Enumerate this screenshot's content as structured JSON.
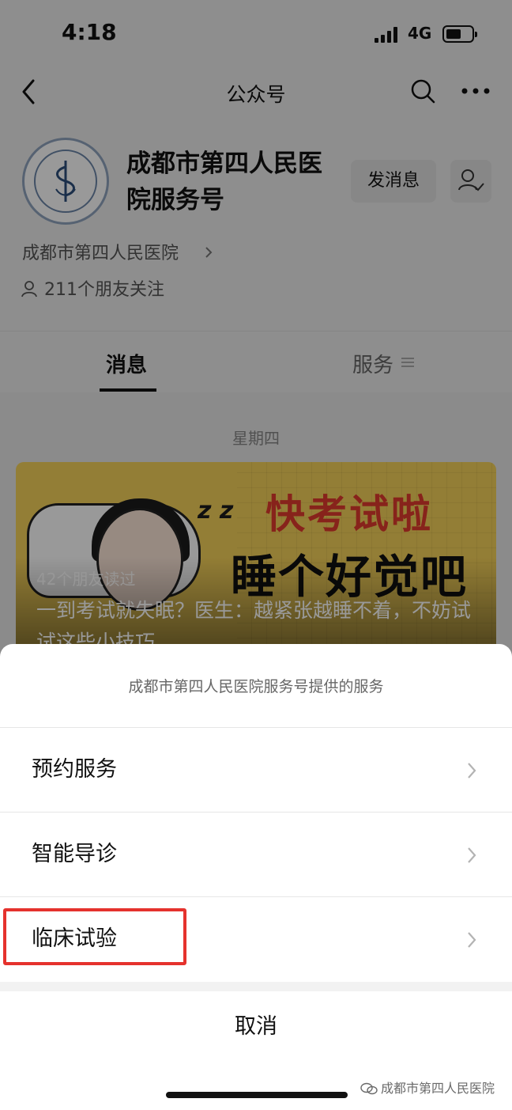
{
  "status_bar": {
    "time": "4:18",
    "network": "4G"
  },
  "navbar": {
    "title": "公众号",
    "icons": [
      "back-icon",
      "search-icon",
      "more-icon"
    ]
  },
  "profile": {
    "account_name": "成都市第四人民医院服务号",
    "send_message_label": "发消息",
    "org_name": "成都市第四人民医院",
    "friends_follow": "211个朋友关注"
  },
  "tabs": {
    "messages_label": "消息",
    "services_label": "服务"
  },
  "feed": {
    "date": "星期四",
    "article": {
      "headline_1": "快考试啦",
      "headline_2": "睡个好觉吧",
      "reads": "42个朋友读过",
      "title": "一到考试就失眠？医生：越紧张越睡不着，不妨试试这些小技巧"
    }
  },
  "sheet": {
    "header": "成都市第四人民医院服务号提供的服务",
    "items": [
      {
        "label": "预约服务"
      },
      {
        "label": "智能导诊"
      },
      {
        "label": "临床试验"
      }
    ],
    "cancel_label": "取消"
  },
  "watermark": "成都市第四人民医院",
  "colors": {
    "highlight": "#e5322d",
    "headline_red": "#e23b2e",
    "banner_yellow": "#f6d25a"
  }
}
